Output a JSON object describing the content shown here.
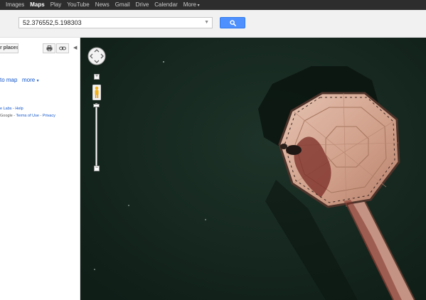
{
  "nav": {
    "items": [
      {
        "label": "Images",
        "active": false
      },
      {
        "label": "Maps",
        "active": true
      },
      {
        "label": "Play",
        "active": false
      },
      {
        "label": "YouTube",
        "active": false
      },
      {
        "label": "News",
        "active": false
      },
      {
        "label": "Gmail",
        "active": false
      },
      {
        "label": "Drive",
        "active": false
      },
      {
        "label": "Calendar",
        "active": false
      },
      {
        "label": "More",
        "active": false
      }
    ]
  },
  "search": {
    "value": "52.376552,5.198303",
    "dropdown_icon": "chevron-down-icon",
    "button_icon": "search-icon",
    "button_color": "#4d90fe"
  },
  "sidebar": {
    "places_label": "r places",
    "print_icon": "print-icon",
    "link_icon": "link-icon",
    "collapse_icon": "chevron-left-icon",
    "add_to_map": "to map",
    "more": "more",
    "labs_text": "e Labs",
    "help_text": "Help",
    "footer_prefix": "Google - ",
    "terms_text": "Terms of Use",
    "privacy_text": "Privacy"
  },
  "map": {
    "view": "satellite",
    "zoom_in": "+",
    "zoom_out": "−",
    "pegman_icon": "pegman-icon",
    "water_color": "#15271f",
    "deck_color": "#cf9e88"
  }
}
